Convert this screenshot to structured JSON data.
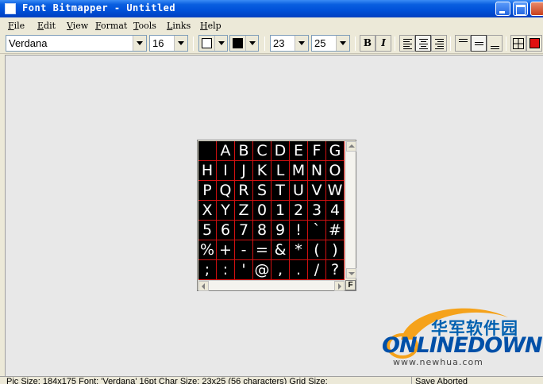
{
  "window": {
    "title": "Font Bitmapper - Untitled"
  },
  "menu": [
    "File",
    "Edit",
    "View",
    "Format",
    "Tools",
    "Links",
    "Help"
  ],
  "toolbar": {
    "font_name": "Verdana",
    "font_size": "16",
    "bg_color": "#FFFFFF",
    "fg_color": "#000000",
    "char_width": "23",
    "char_height": "25",
    "bold_label": "B",
    "italic_label": "I",
    "grid_color": "#E01010"
  },
  "glyph_grid": {
    "characters": [
      "",
      "A",
      "B",
      "C",
      "D",
      "E",
      "F",
      "G",
      "H",
      "I",
      "J",
      "K",
      "L",
      "M",
      "N",
      "O",
      "P",
      "Q",
      "R",
      "S",
      "T",
      "U",
      "V",
      "W",
      "X",
      "Y",
      "Z",
      "0",
      "1",
      "2",
      "3",
      "4",
      "5",
      "6",
      "7",
      "8",
      "9",
      "!",
      "`",
      "#",
      "%",
      "+",
      "-",
      "=",
      "&",
      "*",
      "(",
      ")",
      ";",
      ":",
      "'",
      "@",
      ",",
      ".",
      "/",
      "?"
    ],
    "corner_label": "F"
  },
  "watermark": {
    "cn": "华军软件园",
    "brand": "ONLINEDOWN",
    "url": "www.newhua.com"
  },
  "status": {
    "info": "Pic Size: 184x175  Font: 'Verdana' 16pt  Char Size: 23x25 (56 characters)  Grid Size:",
    "message": "Save Aborted"
  }
}
